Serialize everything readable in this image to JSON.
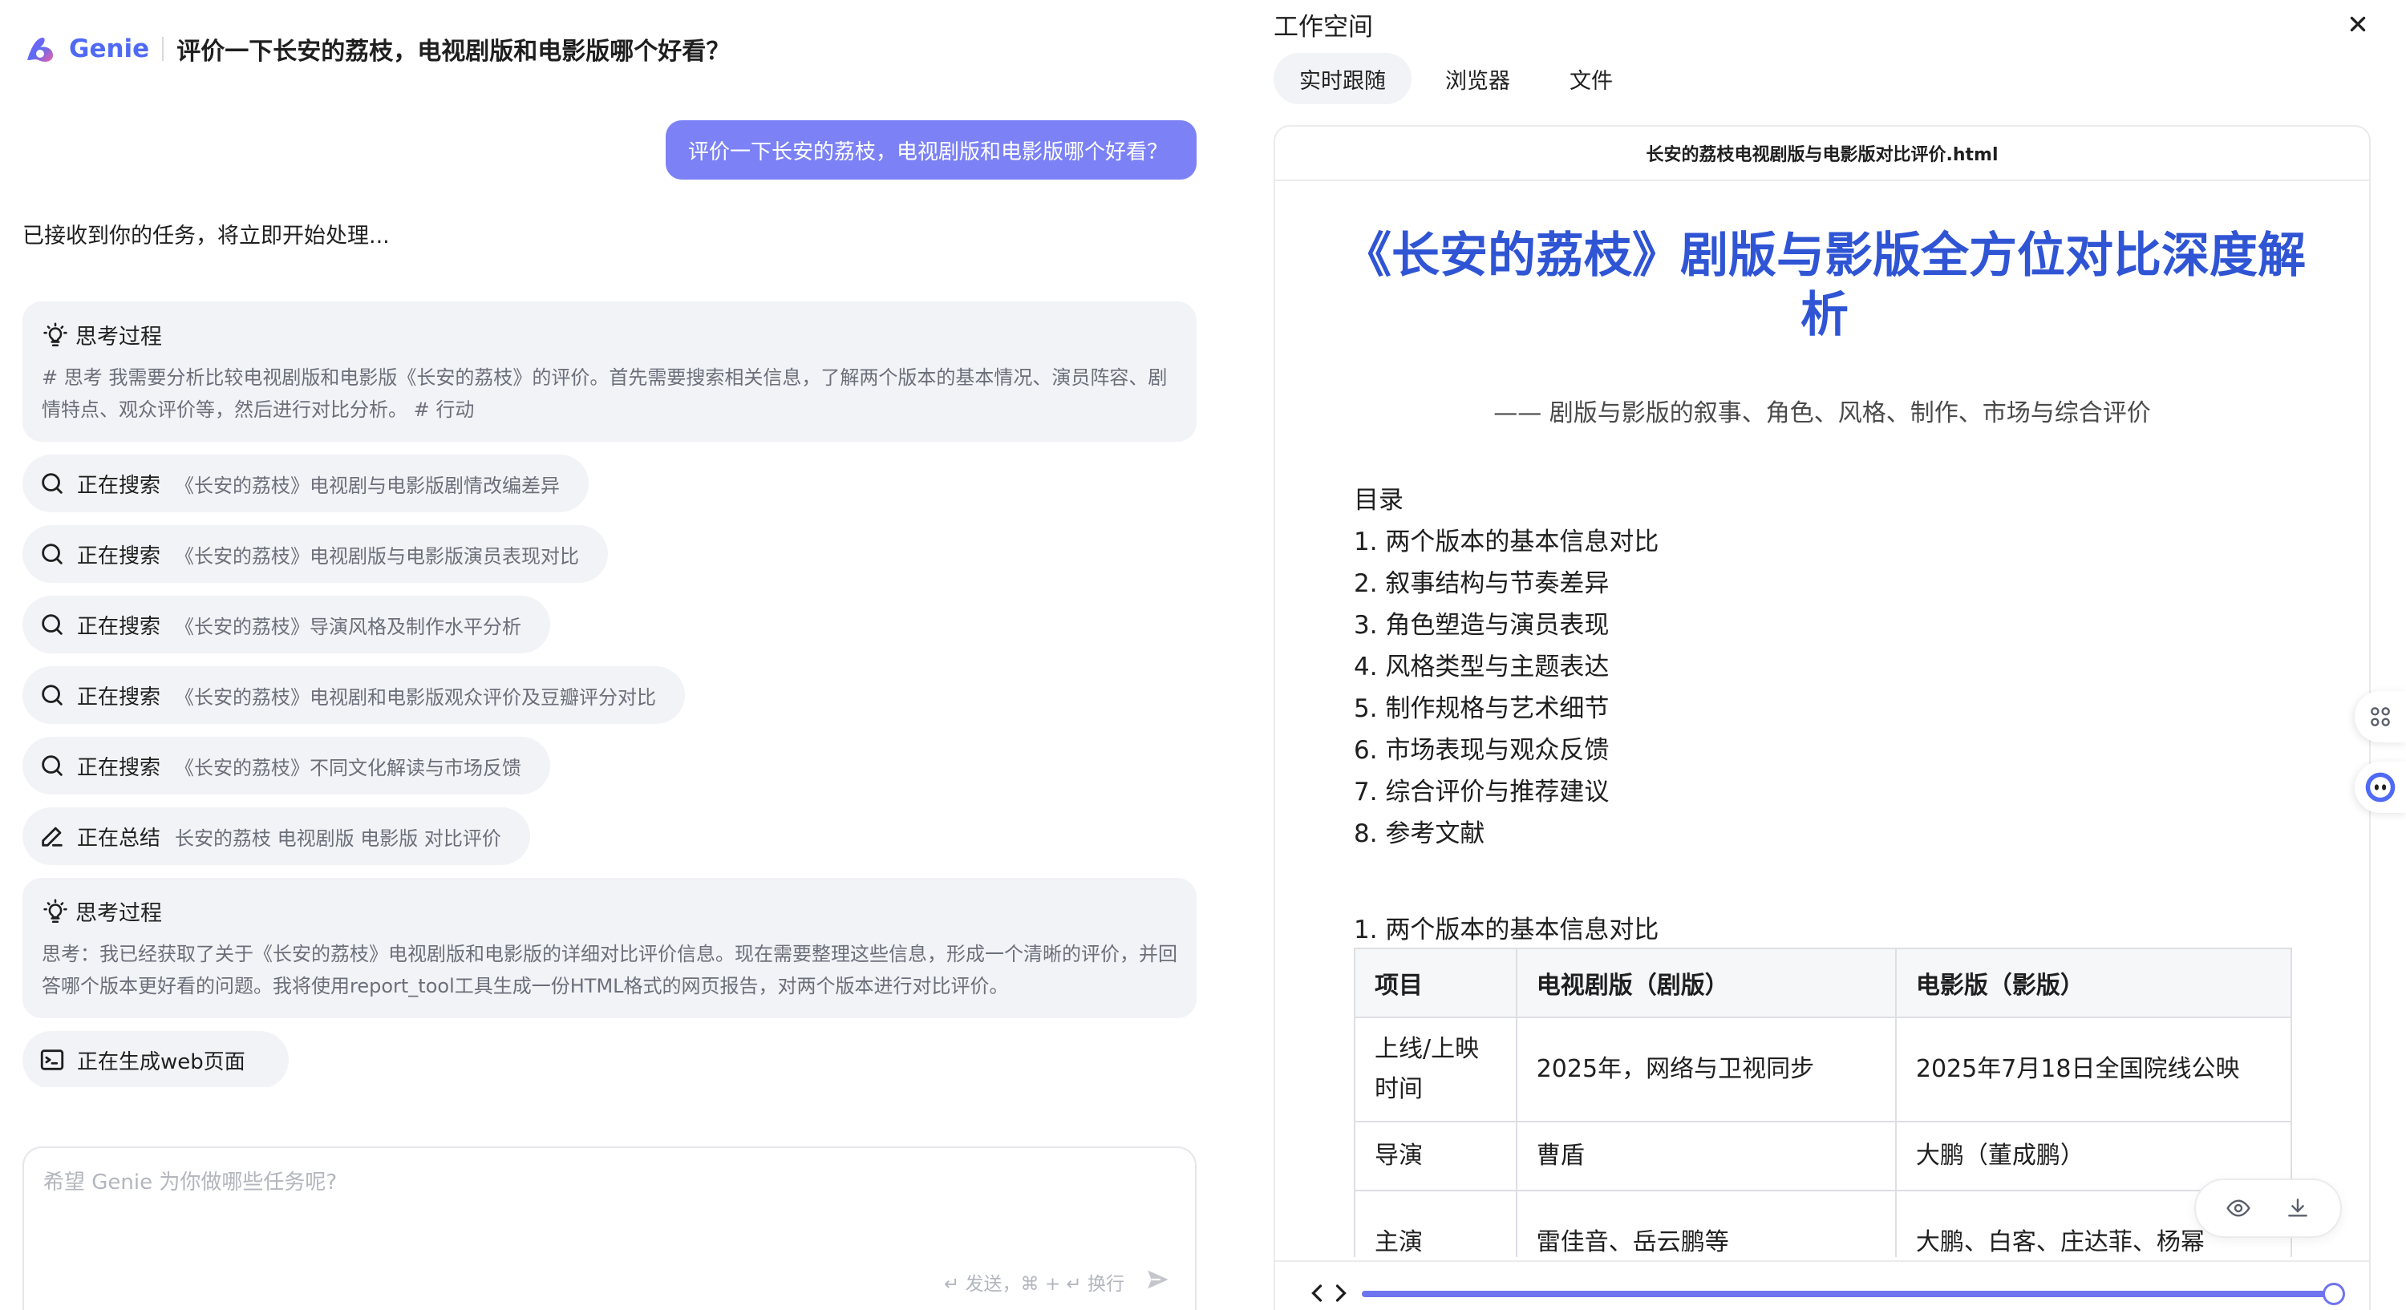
{
  "header": {
    "logo_text": "Genie",
    "chat_title": "评价一下长安的荔枝，电视剧版和电影版哪个好看？"
  },
  "conversation": {
    "user_message": "评价一下长安的荔枝，电视剧版和电影版哪个好看？",
    "ack_message": "已接收到你的任务，将立即开始处理...",
    "thinking_1": {
      "label": "思考过程",
      "text": "# 思考 我需要分析比较电视剧版和电影版《长安的荔枝》的评价。首先需要搜索相关信息，了解两个版本的基本情况、演员阵容、剧情特点、观众评价等，然后进行对比分析。 # 行动"
    },
    "steps": [
      {
        "icon": "search-icon",
        "label": "正在搜索",
        "query": "《长安的荔枝》电视剧与电影版剧情改编差异"
      },
      {
        "icon": "search-icon",
        "label": "正在搜索",
        "query": "《长安的荔枝》电视剧版与电影版演员表现对比"
      },
      {
        "icon": "search-icon",
        "label": "正在搜索",
        "query": "《长安的荔枝》导演风格及制作水平分析"
      },
      {
        "icon": "search-icon",
        "label": "正在搜索",
        "query": "《长安的荔枝》电视剧和电影版观众评价及豆瓣评分对比"
      },
      {
        "icon": "search-icon",
        "label": "正在搜索",
        "query": "《长安的荔枝》不同文化解读与市场反馈"
      },
      {
        "icon": "edit-icon",
        "label": "正在总结",
        "query": "长安的荔枝 电视剧版 电影版 对比评价"
      }
    ],
    "thinking_2": {
      "label": "思考过程",
      "text": "思考：我已经获取了关于《长安的荔枝》电视剧版和电影版的详细对比评价信息。现在需要整理这些信息，形成一个清晰的评价，并回答哪个版本更好看的问题。我将使用report_tool工具生成一份HTML格式的网页报告，对两个版本进行对比评价。"
    },
    "generating_label": "正在生成web页面"
  },
  "composer": {
    "placeholder": "希望 Genie 为你做哪些任务呢?",
    "hint": "↵ 发送，⌘ + ↵ 换行"
  },
  "workspace": {
    "title": "工作空间",
    "tabs": [
      "实时跟随",
      "浏览器",
      "文件"
    ],
    "active_tab": 0,
    "file_name": "长安的荔枝电视剧版与电影版对比评价.html",
    "document": {
      "title": "《长安的荔枝》剧版与影版全方位对比深度解析",
      "subtitle": "—— 剧版与影版的叙事、角色、风格、制作、市场与综合评价",
      "toc_heading": "目录",
      "toc": [
        "1. 两个版本的基本信息对比",
        "2. 叙事结构与节奏差异",
        "3. 角色塑造与演员表现",
        "4. 风格类型与主题表达",
        "5. 制作规格与艺术细节",
        "6. 市场表现与观众反馈",
        "7. 综合评价与推荐建议",
        "8. 参考文献"
      ],
      "section_1_heading": "1. 两个版本的基本信息对比",
      "table": {
        "headers": [
          "项目",
          "电视剧版（剧版）",
          "电影版（影版）"
        ],
        "rows": [
          [
            "上线/上映时间",
            "2025年，网络与卫视同步",
            "2025年7月18日全国院线公映"
          ],
          [
            "导演",
            "曹盾",
            "大鹏（董成鹏）"
          ],
          [
            "主演",
            "雷佳音、岳云鹏等",
            "大鹏、白客、庄达菲、杨幂"
          ]
        ]
      }
    },
    "playback_progress": 0.99
  },
  "colors": {
    "brand": "#4f6af5",
    "user_bubble": "#7c82f5",
    "doc_title": "#2f55d4",
    "progress": "#6f74ef"
  }
}
